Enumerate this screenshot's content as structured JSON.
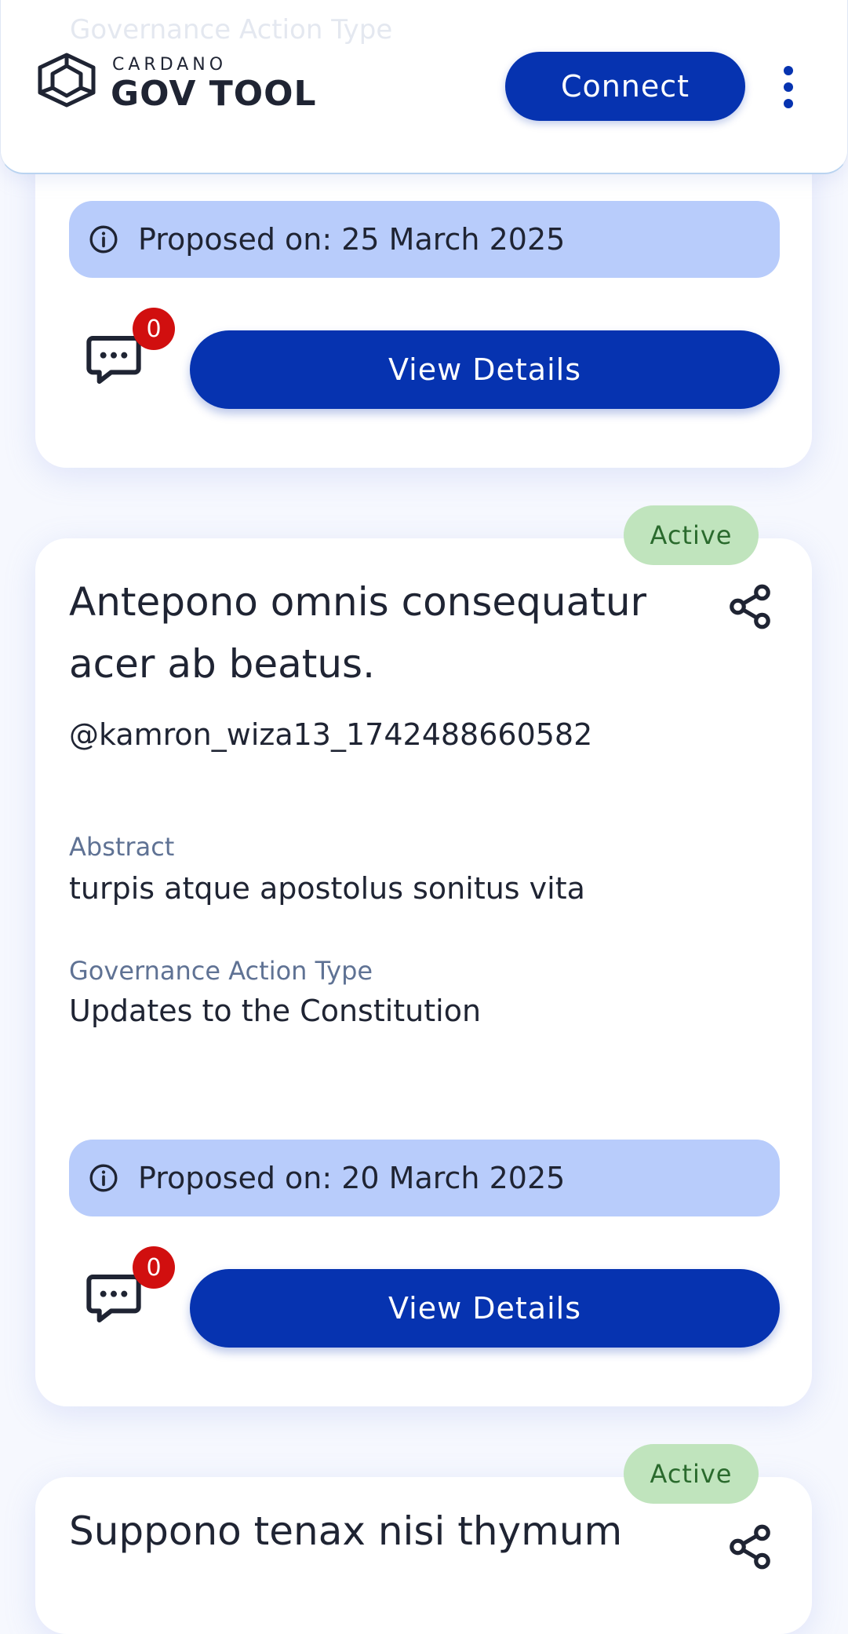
{
  "header": {
    "brand_top": "CARDANO",
    "brand_bottom": "GOV TOOL",
    "connect_label": "Connect",
    "ghost_text": "Governance Action Type"
  },
  "cards": [
    {
      "proposed": "Proposed on: 25 March 2025",
      "comment_count": "0",
      "view_label": "View Details"
    },
    {
      "status": "Active",
      "title": "Antepono omnis consequatur acer ab beatus.",
      "username": "@kamron_wiza13_1742488660582",
      "abstract_label": "Abstract",
      "abstract": "turpis atque apostolus sonitus vita",
      "type_label": "Governance Action Type",
      "type": "Updates to the Constitution",
      "proposed": "Proposed on: 20 March 2025",
      "comment_count": "0",
      "view_label": "View Details"
    },
    {
      "status": "Active",
      "title": "Suppono tenax nisi thymum"
    }
  ],
  "colors": {
    "primary": "#0633b0",
    "status_bg": "#c0e4bd",
    "status_text": "#2a6a2d",
    "proposed_bg": "#b8ccfb",
    "count_badge": "#d10f0f"
  },
  "icons": [
    "cardano-logo-icon",
    "more-vertical-icon",
    "share-icon",
    "info-icon",
    "comment-icon"
  ]
}
